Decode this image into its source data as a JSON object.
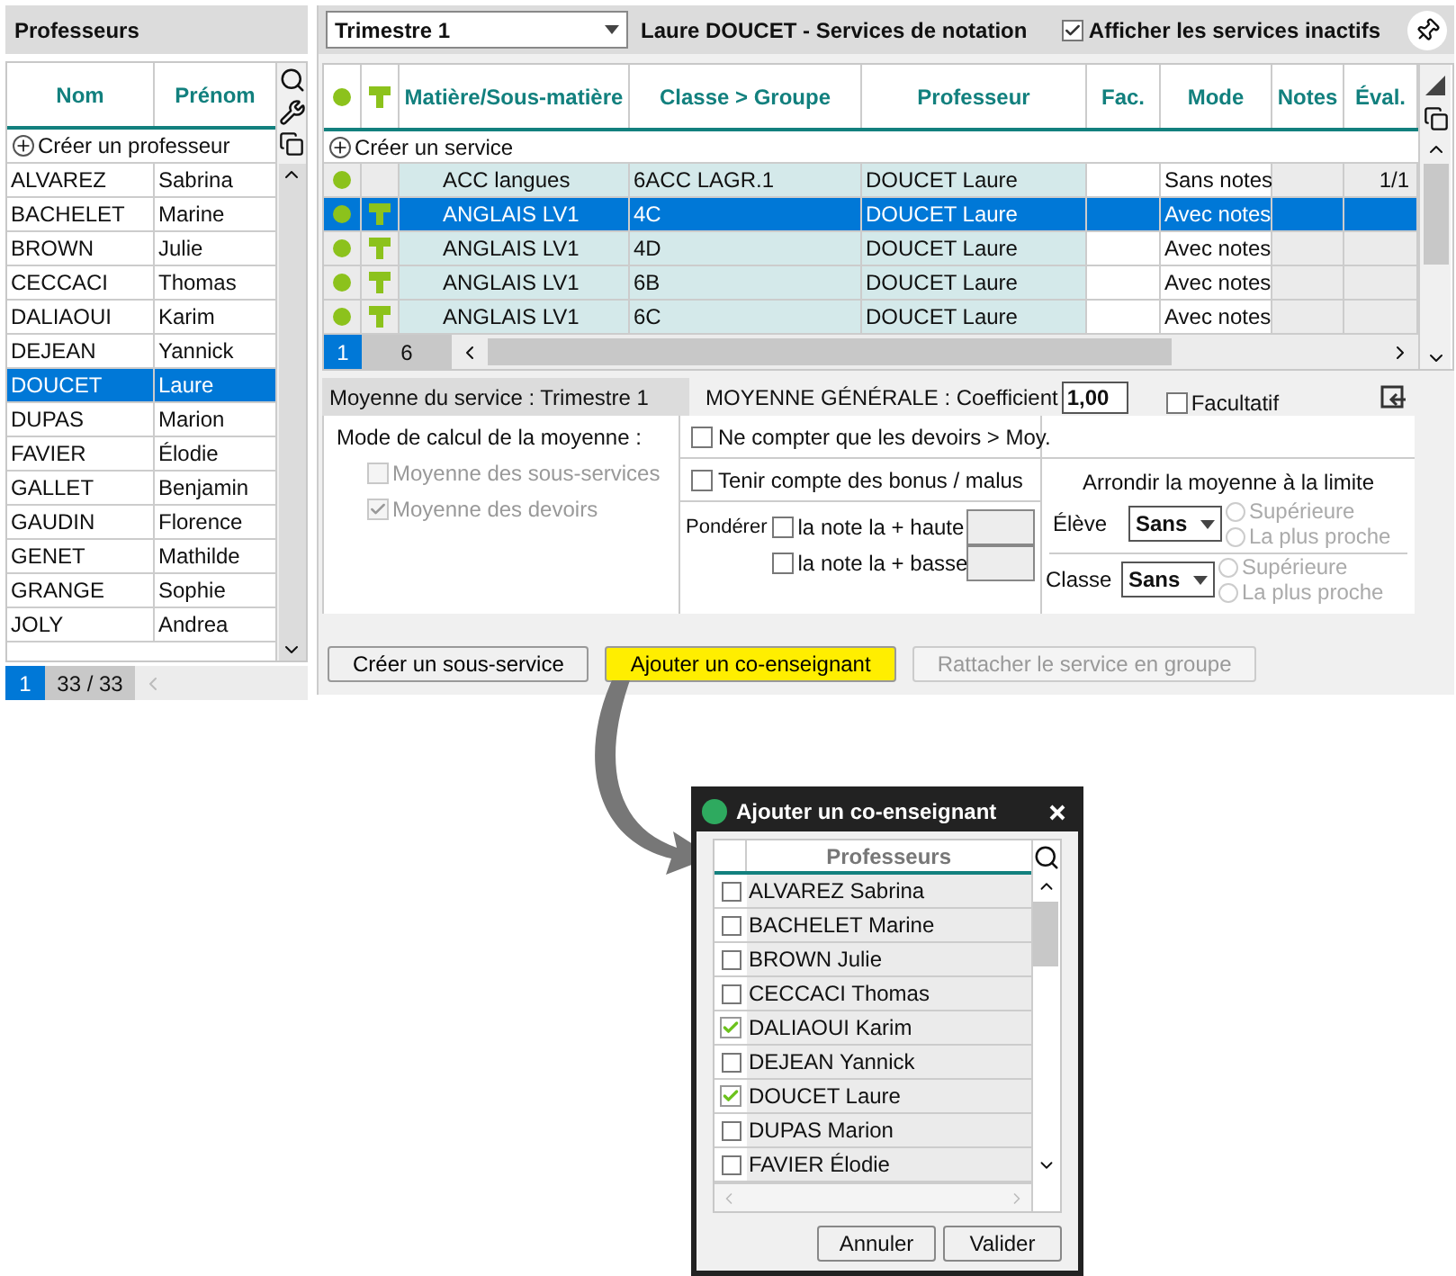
{
  "teachers_panel": {
    "title": "Professeurs",
    "columns": [
      "Nom",
      "Prénom"
    ],
    "create_label": "Créer un professeur",
    "rows": [
      {
        "nom": "ALVAREZ",
        "prenom": "Sabrina",
        "selected": false
      },
      {
        "nom": "BACHELET",
        "prenom": "Marine",
        "selected": false
      },
      {
        "nom": "BROWN",
        "prenom": "Julie",
        "selected": false
      },
      {
        "nom": "CECCACI",
        "prenom": "Thomas",
        "selected": false
      },
      {
        "nom": "DALIAOUI",
        "prenom": "Karim",
        "selected": false
      },
      {
        "nom": "DEJEAN",
        "prenom": "Yannick",
        "selected": false
      },
      {
        "nom": "DOUCET",
        "prenom": "Laure",
        "selected": true
      },
      {
        "nom": "DUPAS",
        "prenom": "Marion",
        "selected": false
      },
      {
        "nom": "FAVIER",
        "prenom": "Élodie",
        "selected": false
      },
      {
        "nom": "GALLET",
        "prenom": "Benjamin",
        "selected": false
      },
      {
        "nom": "GAUDIN",
        "prenom": "Florence",
        "selected": false
      },
      {
        "nom": "GENET",
        "prenom": "Mathilde",
        "selected": false
      },
      {
        "nom": "GRANGE",
        "prenom": "Sophie",
        "selected": false
      },
      {
        "nom": "JOLY",
        "prenom": "Andrea",
        "selected": false
      }
    ],
    "page": "1",
    "count": "33 / 33"
  },
  "services_panel": {
    "period": "Trimestre 1",
    "title": "Laure DOUCET - Services de notation",
    "show_inactive": {
      "label": "Afficher les services inactifs",
      "checked": true
    },
    "columns": [
      "Matière/Sous-matière",
      "Classe > Groupe",
      "Professeur",
      "Fac.",
      "Mode",
      "Notes",
      "Éval."
    ],
    "create_label": "Créer un service",
    "rows": [
      {
        "active": true,
        "group_icon": false,
        "subject": "ACC langues",
        "group": "6ACC LAGR.1",
        "teacher": "DOUCET Laure",
        "mode": "Sans notes",
        "eval": "1/1",
        "selected": false
      },
      {
        "active": true,
        "group_icon": true,
        "subject": "ANGLAIS LV1",
        "group": "4C",
        "teacher": "DOUCET Laure",
        "mode": "Avec notes",
        "selected": true
      },
      {
        "active": true,
        "group_icon": true,
        "subject": "ANGLAIS LV1",
        "group": "4D",
        "teacher": "DOUCET Laure",
        "mode": "Avec notes",
        "selected": false
      },
      {
        "active": true,
        "group_icon": true,
        "subject": "ANGLAIS LV1",
        "group": "6B",
        "teacher": "DOUCET Laure",
        "mode": "Avec notes",
        "selected": false
      },
      {
        "active": true,
        "group_icon": true,
        "subject": "ANGLAIS LV1",
        "group": "6C",
        "teacher": "DOUCET Laure",
        "mode": "Avec notes",
        "selected": false
      }
    ],
    "page": "1",
    "count": "6"
  },
  "average": {
    "header": "Moyenne du service :  Trimestre 1",
    "general_label": "MOYENNE GÉNÉRALE : Coefficient",
    "coefficient": "1,00",
    "optional": {
      "label": "Facultatif",
      "checked": false
    },
    "calc_title": "Mode de calcul de la moyenne :",
    "calc_options": [
      {
        "label": "Moyenne des sous-services",
        "checked": false,
        "disabled": true
      },
      {
        "label": "Moyenne des devoirs",
        "checked": true,
        "disabled": true
      }
    ],
    "options": [
      {
        "label": "Ne compter que les devoirs > Moy.",
        "checked": false
      },
      {
        "label": "Tenir compte des bonus / malus",
        "checked": false
      }
    ],
    "weight_label": "Pondérer",
    "weights": [
      {
        "label": "la note la + haute",
        "checked": false
      },
      {
        "label": "la note la + basse",
        "checked": false
      }
    ],
    "rounding_title": "Arrondir la moyenne à la limite",
    "rounding": [
      {
        "label": "Élève",
        "value": "Sans",
        "choices": [
          {
            "label": "Supérieure",
            "selected": false
          },
          {
            "label": "La plus proche",
            "selected": false
          }
        ]
      },
      {
        "label": "Classe",
        "value": "Sans",
        "choices": [
          {
            "label": "Supérieure",
            "selected": false
          },
          {
            "label": "La plus proche",
            "selected": false
          }
        ]
      }
    ]
  },
  "buttons": [
    {
      "label": "Créer un sous-service",
      "kind": "normal"
    },
    {
      "label": "Ajouter un co-enseignant",
      "kind": "highlight"
    },
    {
      "label": "Rattacher le service en groupe",
      "kind": "disabled"
    }
  ],
  "dialog": {
    "title": "Ajouter un co-enseignant",
    "header": "Professeurs",
    "rows": [
      {
        "name": "ALVAREZ Sabrina",
        "checked": false
      },
      {
        "name": "BACHELET Marine",
        "checked": false
      },
      {
        "name": "BROWN Julie",
        "checked": false
      },
      {
        "name": "CECCACI Thomas",
        "checked": false
      },
      {
        "name": "DALIAOUI Karim",
        "checked": true
      },
      {
        "name": "DEJEAN Yannick",
        "checked": false
      },
      {
        "name": "DOUCET Laure",
        "checked": true
      },
      {
        "name": "DUPAS Marion",
        "checked": false
      },
      {
        "name": "FAVIER Élodie",
        "checked": false
      }
    ],
    "buttons": [
      "Annuler",
      "Valider"
    ]
  }
}
